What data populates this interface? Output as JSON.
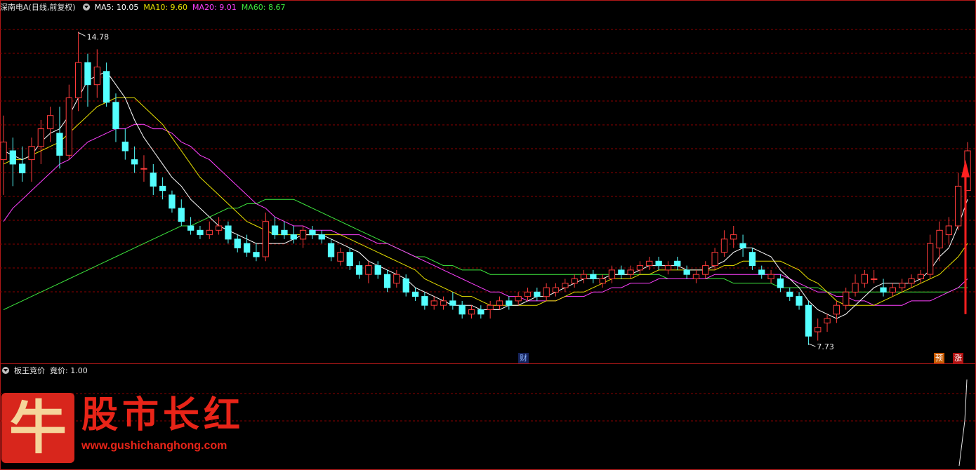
{
  "header": {
    "stock_label": "深南电A(日线,前复权)",
    "ma5": "MA5: 10.05",
    "ma10": "MA10: 9.60",
    "ma20": "MA20: 9.01",
    "ma60": "MA60: 8.67"
  },
  "sub_header": {
    "indicator": "板王竞价",
    "value": "竟价: 1.00"
  },
  "markers": {
    "cai": "财",
    "yu": "预",
    "zhang": "涨"
  },
  "logo": {
    "char": "牛",
    "title": "股市长红",
    "url": "www.gushichanghong.com"
  },
  "colors": {
    "background": "#000000",
    "up": "#ff3b3b",
    "down": "#54ffff",
    "ma5": "#ffffff",
    "ma10": "#e8e000",
    "ma20": "#ff40ff",
    "ma60": "#3ee83e",
    "grid": "#8a0000",
    "divider": "#b01818"
  },
  "chart_data": {
    "type": "candlestick",
    "annotations": {
      "high_label": "14.78",
      "high": 14.78,
      "low_label": "7.73",
      "low": 7.73
    },
    "ylim": [
      7.3,
      15.2
    ],
    "candles": [
      [
        11.9,
        12.9,
        11.1,
        12.3
      ],
      [
        12.1,
        12.4,
        11.3,
        11.8
      ],
      [
        11.8,
        12.2,
        11.4,
        11.6
      ],
      [
        11.9,
        12.4,
        11.4,
        12.2
      ],
      [
        12.2,
        12.8,
        11.8,
        12.6
      ],
      [
        12.6,
        13.1,
        12.3,
        12.9
      ],
      [
        12.5,
        13.1,
        11.7,
        12.0
      ],
      [
        12.0,
        13.6,
        11.9,
        13.3
      ],
      [
        13.3,
        14.8,
        13.0,
        14.1
      ],
      [
        14.1,
        14.3,
        13.1,
        13.6
      ],
      [
        13.6,
        14.4,
        13.3,
        14.0
      ],
      [
        13.9,
        14.1,
        13.1,
        13.2
      ],
      [
        13.2,
        13.4,
        12.3,
        12.6
      ],
      [
        12.3,
        12.6,
        11.9,
        12.1
      ],
      [
        11.9,
        12.2,
        11.6,
        11.8
      ],
      [
        11.7,
        12.0,
        11.4,
        11.7
      ],
      [
        11.6,
        11.8,
        11.1,
        11.3
      ],
      [
        11.3,
        11.5,
        11.0,
        11.2
      ],
      [
        11.1,
        11.2,
        10.7,
        10.8
      ],
      [
        10.8,
        11.0,
        10.4,
        10.5
      ],
      [
        10.4,
        10.6,
        10.2,
        10.3
      ],
      [
        10.3,
        10.4,
        10.1,
        10.2
      ],
      [
        10.2,
        10.5,
        10.1,
        10.3
      ],
      [
        10.3,
        10.6,
        10.2,
        10.4
      ],
      [
        10.4,
        10.5,
        10.0,
        10.1
      ],
      [
        10.1,
        10.2,
        9.8,
        9.9
      ],
      [
        10.0,
        10.2,
        9.7,
        9.8
      ],
      [
        9.8,
        10.0,
        9.6,
        9.7
      ],
      [
        9.7,
        10.7,
        9.6,
        10.5
      ],
      [
        10.4,
        10.6,
        10.1,
        10.2
      ],
      [
        10.3,
        10.5,
        10.1,
        10.2
      ],
      [
        10.2,
        10.4,
        10.0,
        10.1
      ],
      [
        10.1,
        10.4,
        9.9,
        10.3
      ],
      [
        10.3,
        10.4,
        10.1,
        10.2
      ],
      [
        10.2,
        10.3,
        10.0,
        10.1
      ],
      [
        10.0,
        10.1,
        9.6,
        9.7
      ],
      [
        9.6,
        9.9,
        9.5,
        9.8
      ],
      [
        9.8,
        9.9,
        9.4,
        9.5
      ],
      [
        9.5,
        9.6,
        9.2,
        9.3
      ],
      [
        9.3,
        9.6,
        9.1,
        9.5
      ],
      [
        9.5,
        9.6,
        9.2,
        9.3
      ],
      [
        9.3,
        9.4,
        8.9,
        9.0
      ],
      [
        9.1,
        9.4,
        9.0,
        9.3
      ],
      [
        9.2,
        9.3,
        8.8,
        8.9
      ],
      [
        8.9,
        9.0,
        8.7,
        8.8
      ],
      [
        8.8,
        8.9,
        8.5,
        8.6
      ],
      [
        8.6,
        8.8,
        8.5,
        8.7
      ],
      [
        8.6,
        8.8,
        8.5,
        8.7
      ],
      [
        8.7,
        8.9,
        8.5,
        8.6
      ],
      [
        8.6,
        8.7,
        8.3,
        8.4
      ],
      [
        8.4,
        8.6,
        8.3,
        8.5
      ],
      [
        8.5,
        8.6,
        8.3,
        8.4
      ],
      [
        8.5,
        8.7,
        8.3,
        8.6
      ],
      [
        8.6,
        8.8,
        8.5,
        8.7
      ],
      [
        8.7,
        8.8,
        8.5,
        8.6
      ],
      [
        8.7,
        8.9,
        8.6,
        8.8
      ],
      [
        8.8,
        9.0,
        8.7,
        8.9
      ],
      [
        8.9,
        9.0,
        8.7,
        8.8
      ],
      [
        8.8,
        9.1,
        8.7,
        9.0
      ],
      [
        8.9,
        9.1,
        8.8,
        9.0
      ],
      [
        9.0,
        9.2,
        8.9,
        9.1
      ],
      [
        9.1,
        9.3,
        9.0,
        9.2
      ],
      [
        9.2,
        9.4,
        9.1,
        9.3
      ],
      [
        9.3,
        9.4,
        9.1,
        9.2
      ],
      [
        9.1,
        9.3,
        9.0,
        9.2
      ],
      [
        9.2,
        9.5,
        9.1,
        9.4
      ],
      [
        9.4,
        9.5,
        9.2,
        9.3
      ],
      [
        9.3,
        9.5,
        9.2,
        9.4
      ],
      [
        9.4,
        9.6,
        9.3,
        9.5
      ],
      [
        9.5,
        9.7,
        9.4,
        9.6
      ],
      [
        9.6,
        9.7,
        9.4,
        9.5
      ],
      [
        9.4,
        9.6,
        9.3,
        9.5
      ],
      [
        9.6,
        9.7,
        9.4,
        9.5
      ],
      [
        9.4,
        9.5,
        9.2,
        9.3
      ],
      [
        9.2,
        9.4,
        9.1,
        9.3
      ],
      [
        9.3,
        9.6,
        9.2,
        9.5
      ],
      [
        9.5,
        9.9,
        9.4,
        9.8
      ],
      [
        9.8,
        10.3,
        9.7,
        10.1
      ],
      [
        10.1,
        10.4,
        9.9,
        10.2
      ],
      [
        10.0,
        10.2,
        9.7,
        9.9
      ],
      [
        9.8,
        9.9,
        9.4,
        9.5
      ],
      [
        9.4,
        9.5,
        9.2,
        9.3
      ],
      [
        9.2,
        9.4,
        9.1,
        9.3
      ],
      [
        9.2,
        9.3,
        8.9,
        9.0
      ],
      [
        8.9,
        9.0,
        8.7,
        8.8
      ],
      [
        8.8,
        8.9,
        8.5,
        8.6
      ],
      [
        8.6,
        8.7,
        7.7,
        7.9
      ],
      [
        8.0,
        8.3,
        7.8,
        8.1
      ],
      [
        8.2,
        8.4,
        8.0,
        8.3
      ],
      [
        8.4,
        8.7,
        8.2,
        8.6
      ],
      [
        8.6,
        9.0,
        8.5,
        8.9
      ],
      [
        8.9,
        9.3,
        8.8,
        9.1
      ],
      [
        9.1,
        9.4,
        9.0,
        9.3
      ],
      [
        9.2,
        9.4,
        9.1,
        9.2
      ],
      [
        9.0,
        9.2,
        8.8,
        8.9
      ],
      [
        8.9,
        9.1,
        8.8,
        9.0
      ],
      [
        9.0,
        9.2,
        8.9,
        9.1
      ],
      [
        9.1,
        9.3,
        9.0,
        9.2
      ],
      [
        9.2,
        9.4,
        9.1,
        9.3
      ],
      [
        9.3,
        10.2,
        9.2,
        10.0
      ],
      [
        9.9,
        10.5,
        9.6,
        10.3
      ],
      [
        10.2,
        10.6,
        10.0,
        10.4
      ],
      [
        10.4,
        11.6,
        10.3,
        11.3
      ],
      [
        11.2,
        12.3,
        11.2,
        12.1
      ]
    ],
    "ma_series": {
      "MA5": [
        12.1,
        12.0,
        11.9,
        12.0,
        12.3,
        12.5,
        12.6,
        12.9,
        13.3,
        13.7,
        13.8,
        13.9,
        13.6,
        13.3,
        12.8,
        12.4,
        12.1,
        11.8,
        11.5,
        11.3,
        11.0,
        10.8,
        10.6,
        10.4,
        10.3,
        10.2,
        10.1,
        10.0,
        10.0,
        10.0,
        10.0,
        10.1,
        10.2,
        10.2,
        10.2,
        10.1,
        10.0,
        9.9,
        9.8,
        9.6,
        9.5,
        9.4,
        9.3,
        9.2,
        9.0,
        8.9,
        8.8,
        8.7,
        8.6,
        8.6,
        8.6,
        8.5,
        8.5,
        8.5,
        8.6,
        8.6,
        8.7,
        8.8,
        8.8,
        8.9,
        9.0,
        9.1,
        9.2,
        9.2,
        9.2,
        9.3,
        9.3,
        9.3,
        9.4,
        9.5,
        9.5,
        9.5,
        9.5,
        9.4,
        9.4,
        9.4,
        9.5,
        9.6,
        9.8,
        9.9,
        9.9,
        9.8,
        9.7,
        9.4,
        9.2,
        9.0,
        8.7,
        8.5,
        8.4,
        8.3,
        8.4,
        8.6,
        8.8,
        9.0,
        9.1,
        9.1,
        9.1,
        9.1,
        9.2,
        9.4,
        9.7,
        9.9,
        10.4,
        11.0
      ],
      "MA10": [
        11.8,
        11.9,
        11.9,
        12.0,
        12.1,
        12.2,
        12.3,
        12.5,
        12.7,
        12.9,
        13.1,
        13.2,
        13.3,
        13.3,
        13.3,
        13.1,
        12.9,
        12.7,
        12.4,
        12.1,
        11.8,
        11.5,
        11.3,
        11.1,
        10.9,
        10.7,
        10.5,
        10.4,
        10.3,
        10.2,
        10.2,
        10.2,
        10.2,
        10.2,
        10.2,
        10.2,
        10.2,
        10.1,
        10.0,
        9.9,
        9.8,
        9.7,
        9.6,
        9.5,
        9.4,
        9.2,
        9.1,
        9.0,
        8.9,
        8.8,
        8.8,
        8.7,
        8.6,
        8.6,
        8.6,
        8.6,
        8.6,
        8.6,
        8.7,
        8.7,
        8.8,
        8.9,
        8.9,
        9.0,
        9.1,
        9.2,
        9.2,
        9.2,
        9.3,
        9.3,
        9.4,
        9.4,
        9.4,
        9.4,
        9.4,
        9.4,
        9.4,
        9.5,
        9.5,
        9.6,
        9.6,
        9.6,
        9.6,
        9.6,
        9.5,
        9.4,
        9.2,
        9.1,
        8.9,
        8.7,
        8.6,
        8.6,
        8.6,
        8.6,
        8.7,
        8.8,
        8.9,
        9.0,
        9.1,
        9.2,
        9.3,
        9.5,
        9.7,
        10.0
      ],
      "MA20": [
        10.5,
        10.8,
        11.0,
        11.2,
        11.4,
        11.6,
        11.8,
        11.9,
        12.1,
        12.3,
        12.4,
        12.5,
        12.6,
        12.6,
        12.7,
        12.7,
        12.6,
        12.6,
        12.5,
        12.3,
        12.2,
        12.0,
        11.9,
        11.7,
        11.5,
        11.3,
        11.1,
        10.9,
        10.8,
        10.6,
        10.5,
        10.4,
        10.4,
        10.3,
        10.3,
        10.3,
        10.2,
        10.2,
        10.2,
        10.1,
        10.0,
        10.0,
        9.9,
        9.8,
        9.7,
        9.6,
        9.5,
        9.4,
        9.3,
        9.2,
        9.1,
        9.0,
        8.9,
        8.9,
        8.8,
        8.8,
        8.7,
        8.7,
        8.7,
        8.7,
        8.8,
        8.8,
        8.8,
        8.9,
        8.9,
        9.0,
        9.0,
        9.1,
        9.1,
        9.1,
        9.2,
        9.2,
        9.2,
        9.2,
        9.2,
        9.2,
        9.3,
        9.3,
        9.3,
        9.3,
        9.3,
        9.3,
        9.3,
        9.3,
        9.2,
        9.1,
        9.0,
        8.9,
        8.9,
        8.8,
        8.8,
        8.7,
        8.7,
        8.6,
        8.6,
        8.6,
        8.6,
        8.7,
        8.7,
        8.7,
        8.8,
        8.9,
        9.0,
        9.2
      ],
      "MA60": [
        8.5,
        8.6,
        8.7,
        8.8,
        8.9,
        9.0,
        9.1,
        9.2,
        9.3,
        9.4,
        9.5,
        9.6,
        9.7,
        9.8,
        9.9,
        10.0,
        10.1,
        10.2,
        10.3,
        10.4,
        10.4,
        10.5,
        10.6,
        10.7,
        10.8,
        10.8,
        10.9,
        10.9,
        11.0,
        11.0,
        11.0,
        11.0,
        10.9,
        10.8,
        10.7,
        10.6,
        10.5,
        10.4,
        10.3,
        10.2,
        10.1,
        10.0,
        9.9,
        9.8,
        9.7,
        9.7,
        9.6,
        9.5,
        9.5,
        9.4,
        9.4,
        9.4,
        9.3,
        9.3,
        9.3,
        9.3,
        9.3,
        9.3,
        9.3,
        9.3,
        9.3,
        9.3,
        9.3,
        9.3,
        9.3,
        9.3,
        9.3,
        9.3,
        9.3,
        9.3,
        9.3,
        9.2,
        9.2,
        9.2,
        9.2,
        9.2,
        9.2,
        9.2,
        9.1,
        9.1,
        9.1,
        9.1,
        9.1,
        9.0,
        9.0,
        9.0,
        9.0,
        9.0,
        8.9,
        8.9,
        8.9,
        8.9,
        8.9,
        8.9,
        8.9,
        8.9,
        8.9,
        8.9,
        8.9,
        8.9,
        8.9,
        8.9,
        9.0,
        9.0
      ]
    }
  }
}
